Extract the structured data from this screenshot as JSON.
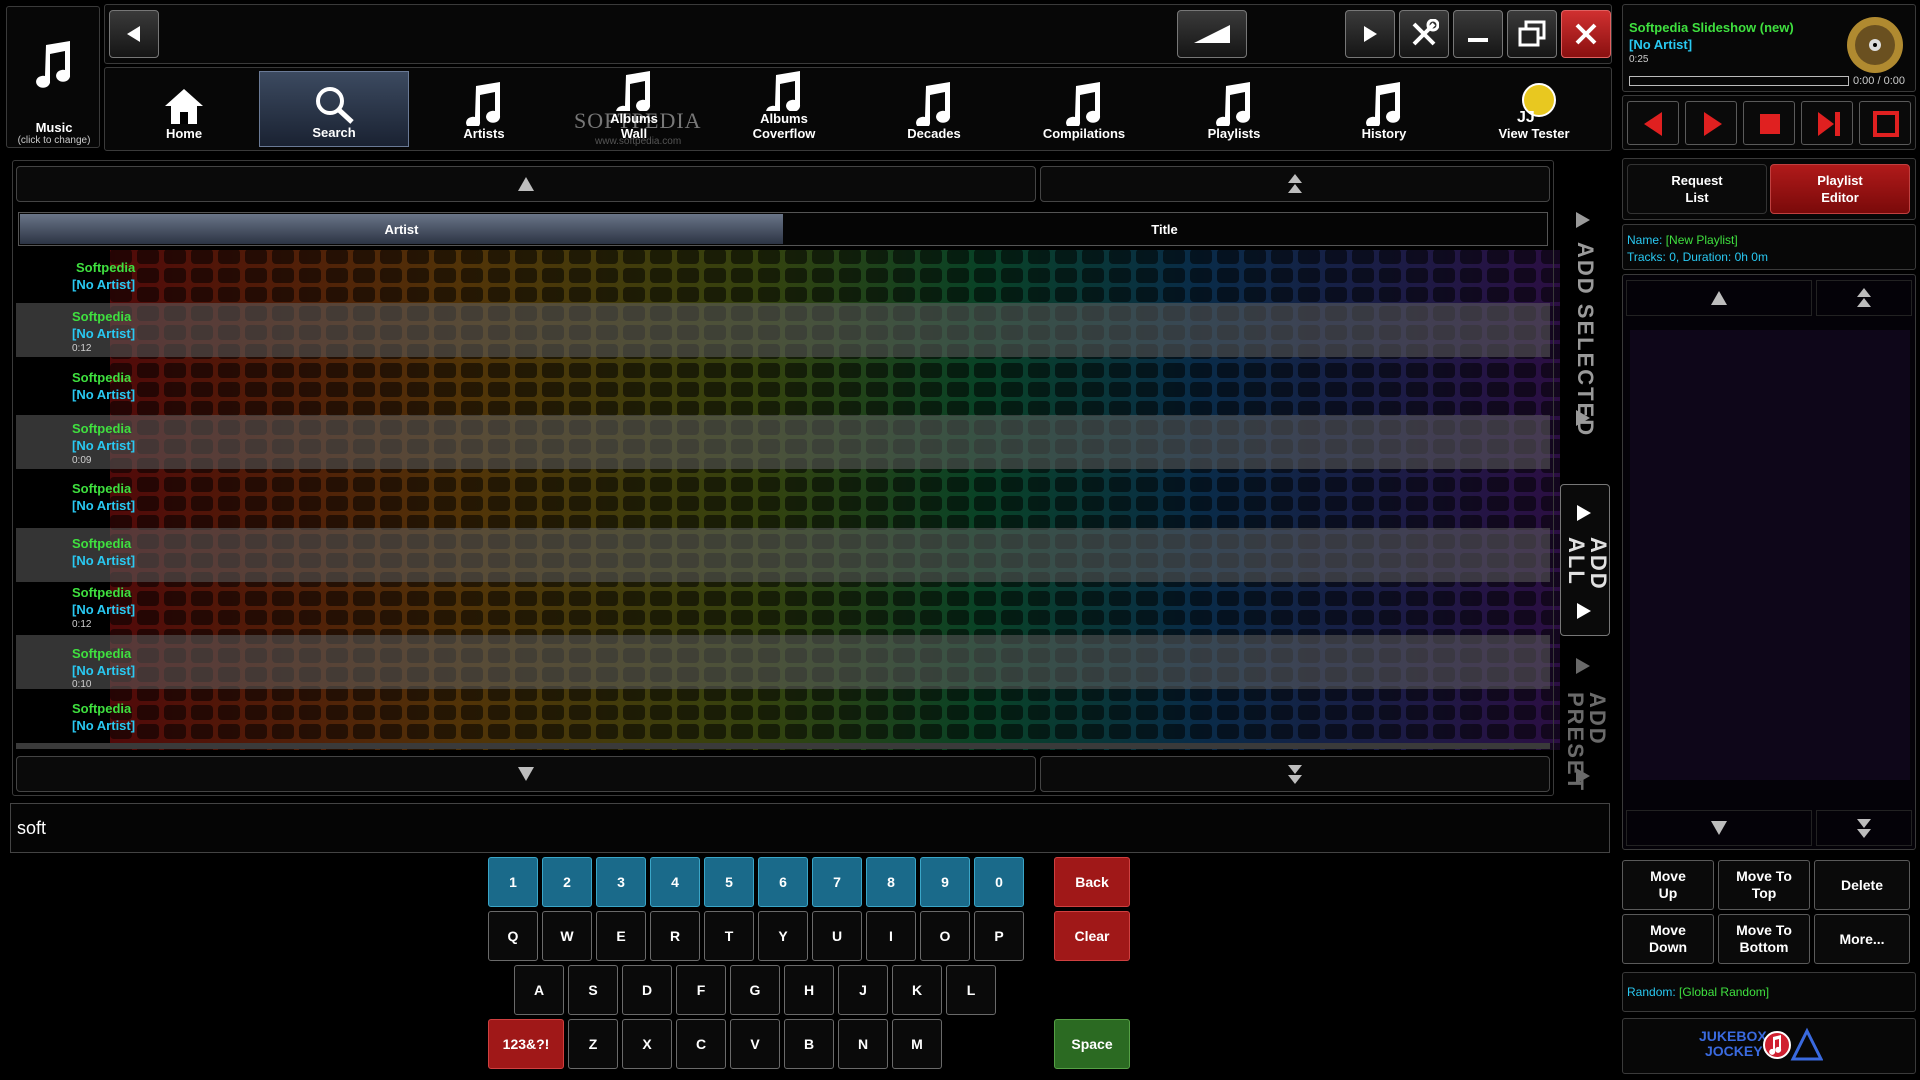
{
  "music_selector": {
    "label": "Music",
    "sublabel": "(click to change)"
  },
  "nav": {
    "items": [
      {
        "label": "Home"
      },
      {
        "label": "Search"
      },
      {
        "label": "Artists"
      },
      {
        "label": "Albums\nWall"
      },
      {
        "label": "Albums\nCoverflow"
      },
      {
        "label": "Decades"
      },
      {
        "label": "Compilations"
      },
      {
        "label": "Playlists"
      },
      {
        "label": "History"
      },
      {
        "label": "View Tester"
      }
    ],
    "watermark": "SOFTPEDIA",
    "watermark_url": "www.softpedia.com"
  },
  "now_playing": {
    "title": "Softpedia Slideshow (new)",
    "artist": "[No Artist]",
    "elapsed": "0:25",
    "time": "0:00 / 0:00",
    "progress": 0
  },
  "columns": {
    "artist": "Artist",
    "title": "Title"
  },
  "results": [
    {
      "title": "Softpedia",
      "artist": "[No Artist]",
      "duration": ""
    },
    {
      "title": "Softpedia",
      "artist": "[No Artist]",
      "duration": "0:12"
    },
    {
      "title": "Softpedia",
      "artist": "[No Artist]",
      "duration": ""
    },
    {
      "title": "Softpedia",
      "artist": "[No Artist]",
      "duration": "0:09"
    },
    {
      "title": "Softpedia",
      "artist": "[No Artist]",
      "duration": ""
    },
    {
      "title": "Softpedia",
      "artist": "[No Artist]",
      "duration": ""
    },
    {
      "title": "Softpedia",
      "artist": "[No Artist]",
      "duration": "0:12"
    },
    {
      "title": "Softpedia",
      "artist": "[No Artist]",
      "duration": "0:10"
    },
    {
      "title": "Softpedia",
      "artist": "[No Artist]",
      "duration": ""
    }
  ],
  "side_actions": {
    "add_selected": "ADD SELECTED",
    "add_all": "ADD ALL",
    "add_preset": "ADD PRESET"
  },
  "search": {
    "value": "soft"
  },
  "keyboard": {
    "numbers": [
      "1",
      "2",
      "3",
      "4",
      "5",
      "6",
      "7",
      "8",
      "9",
      "0"
    ],
    "row1": [
      "Q",
      "W",
      "E",
      "R",
      "T",
      "Y",
      "U",
      "I",
      "O",
      "P"
    ],
    "row2": [
      "A",
      "S",
      "D",
      "F",
      "G",
      "H",
      "J",
      "K",
      "L"
    ],
    "row3": [
      "Z",
      "X",
      "C",
      "V",
      "B",
      "N",
      "M"
    ],
    "symbols": "123&?!",
    "back": "Back",
    "clear": "Clear",
    "space": "Space"
  },
  "right_panel": {
    "tabs": {
      "request_list": "Request\nList",
      "playlist_editor": "Playlist\nEditor"
    },
    "playlist_name_label": "Name:",
    "playlist_name": "[New Playlist]",
    "tracks_info": "Tracks: 0, Duration: 0h 0m",
    "buttons": {
      "move_up": "Move\nUp",
      "move_to_top": "Move To\nTop",
      "delete": "Delete",
      "move_down": "Move\nDown",
      "move_to_bottom": "Move To\nBottom",
      "more": "More..."
    },
    "random_label": "Random:",
    "random_value": "[Global Random]",
    "logo_top": "JUKEBOX",
    "logo_bottom": "JOCKEY"
  },
  "colors": {
    "accent_green": "#3fe03f",
    "accent_cyan": "#29c9f2",
    "active_red": "#9a1212"
  }
}
